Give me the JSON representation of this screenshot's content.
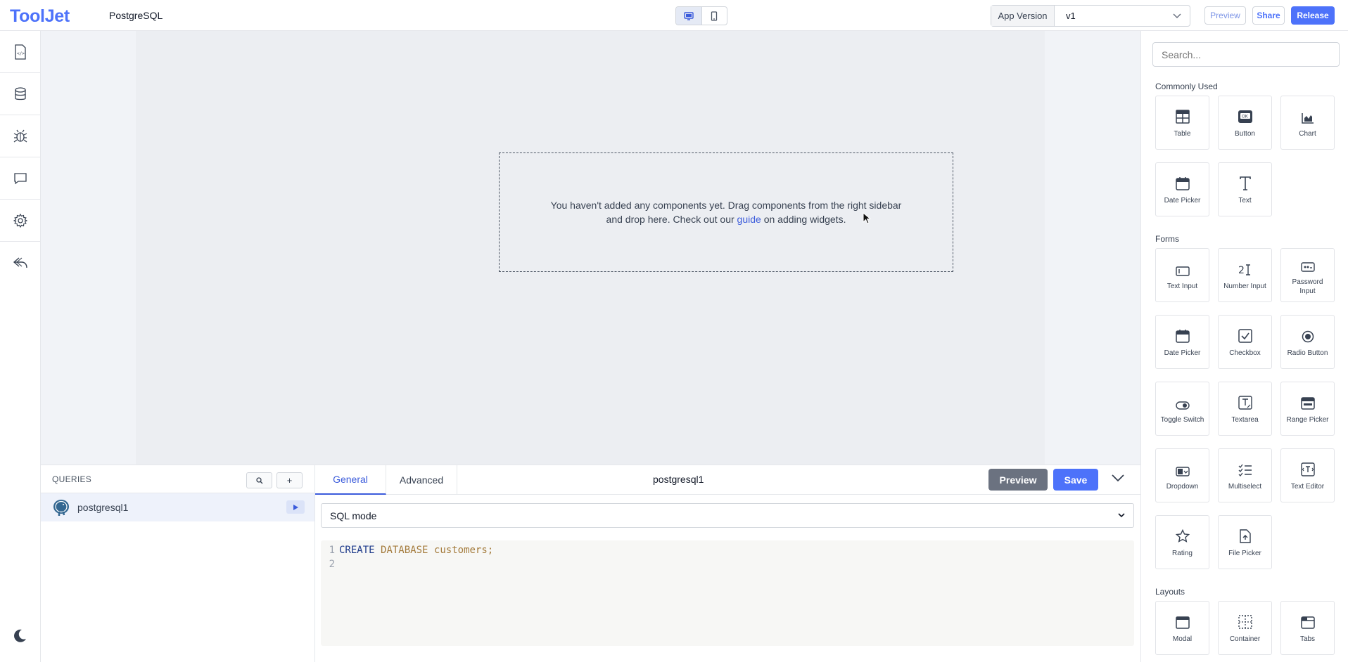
{
  "topbar": {
    "logo": "ToolJet",
    "app_name": "PostgreSQL",
    "version_label": "App Version",
    "version_value": "v1",
    "preview": "Preview",
    "share": "Share",
    "release": "Release"
  },
  "canvas": {
    "empty_line1": "You haven't added any components yet. Drag components from the right sidebar",
    "empty_line2_pre": "and drop here. Check out our ",
    "empty_link": "guide",
    "empty_line2_post": " on adding widgets."
  },
  "queries": {
    "title": "QUERIES",
    "search_icon": "search-icon",
    "add_label": "+",
    "items": [
      {
        "name": "postgresql1"
      }
    ]
  },
  "editor": {
    "tabs": [
      "General",
      "Advanced"
    ],
    "active_tab": "General",
    "query_name": "postgresql1",
    "preview": "Preview",
    "save": "Save",
    "mode": "SQL mode",
    "code": {
      "line_numbers": [
        "1",
        "2"
      ],
      "kw_create": "CREATE",
      "kw_database": "DATABASE",
      "identifier": "customers",
      "terminator": ";"
    }
  },
  "rightbar": {
    "search_placeholder": "Search...",
    "sections": [
      {
        "title": "Commonly Used",
        "widgets": [
          "Table",
          "Button",
          "Chart",
          "Date Picker",
          "Text"
        ]
      },
      {
        "title": "Forms",
        "widgets": [
          "Text Input",
          "Number Input",
          "Password Input",
          "Date Picker",
          "Checkbox",
          "Radio Button",
          "Toggle Switch",
          "Textarea",
          "Range Picker",
          "Dropdown",
          "Multiselect",
          "Text Editor",
          "Rating",
          "File Picker"
        ]
      },
      {
        "title": "Layouts",
        "widgets": [
          "Modal",
          "Container",
          "Tabs"
        ]
      }
    ]
  },
  "colors": {
    "brand": "#4d72fa",
    "canvas_bg": "#eceef2",
    "preview_button": "#6b7280"
  }
}
